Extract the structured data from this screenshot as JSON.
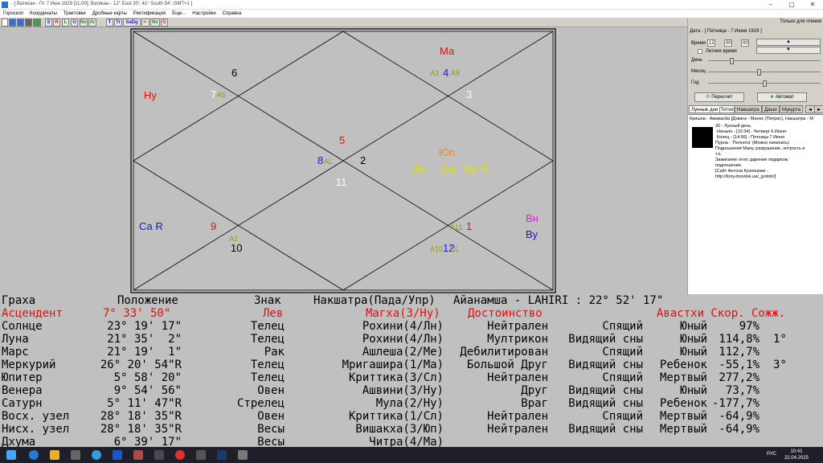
{
  "window": {
    "title": "- [ Ватикан - Пт  7 Июн 1929 [11:00]; Ватикан - 12° East 30'; 41° South 54'; GMT+1 ]",
    "minimize": "–",
    "maximize": "▢",
    "close": "✕"
  },
  "menu": [
    "Гороскоп",
    "Координаты",
    "Трактовки",
    "Дробные карты",
    "Ректификация",
    "Еще...",
    "Настройки",
    "Справка"
  ],
  "toolbar": {
    "buttons": [
      "S",
      "R",
      "L",
      "U",
      "Nv",
      "Ar",
      "T",
      "Tr",
      "SaDg",
      "<-",
      "Nv",
      "G"
    ]
  },
  "chart": {
    "houses": {
      "h1": "5",
      "h2": "6",
      "h3": "7",
      "h4": "8",
      "h5": "9",
      "h6": "10",
      "h7": "11",
      "h8": "12",
      "h9": "1",
      "h10": "2",
      "h11": "3",
      "h12": "4"
    },
    "labels": {
      "ma": "Ма",
      "nu": "Ну",
      "a5": "A5",
      "a3": "A3",
      "a8": "A8",
      "al": "AL",
      "yup": "Юп",
      "ln": "Лн",
      "sl": "Сл",
      "mer": "Ме R",
      "ca": "Са R",
      "a2": "A2",
      "a11": "A11",
      "a10": "A10",
      "ul": "UL",
      "vn": "Вн",
      "vu": "Ву"
    },
    "colors": {
      "red": "#e01010",
      "orange": "#f08a10",
      "yellow": "#e0e000",
      "blue": "#1a1acc",
      "olive": "#9a9a10",
      "white": "#ffffff",
      "magenta": "#e020e0"
    }
  },
  "panel": {
    "readonly": "Только для чтения",
    "date_label": "Дата - [ Пятница   - 7 Июня    1929 ]",
    "time_label": "Время",
    "time_h": "12",
    "time_m": "00",
    "time_s": "00",
    "dst_label": "Летнее время",
    "day_label": "День",
    "month_label": "Месяц",
    "year_label": "Год",
    "day_pos": 0.2,
    "month_pos": 0.45,
    "year_pos": 0.5,
    "recalc": "Пересчет",
    "auto": "Автомат",
    "tabs": [
      "Лунные дни [Титхи]",
      "Накшатра",
      "Даши",
      "Мукурта"
    ],
    "tab_prev": "◄",
    "tab_next": "►",
    "info": {
      "head": "Кришна - Амавасйа [Дэвата - Манес (Питрис), Накшатра - М",
      "l1": "30 - Лунный день",
      "l2": "Начало  - [10:34] - Четверг     6 Июня",
      "l3": "Конец  - [14:56] -  Пятница      7 Июня",
      "l4": "Пурна - 'Полнота' (Можно начинать)",
      "l5": "Подношения Ману, разрушение, хитрость и",
      "l6": "т.п.",
      "l7": "  Зажигание огня; дарение подарков;",
      "l8": "подношения.",
      "l9": "  [Сайт Антона Кузнецова -",
      "l10": "http://tony.donetsk.ua/_jyotish/]"
    }
  },
  "table": {
    "header": {
      "graha": "Граха",
      "pos": "Положение",
      "sign": "Знак",
      "nak": "Накшатра(Пада/Упр)",
      "ayan": "Айанамша - LAHIRI : 22° 52' 17\""
    },
    "asc_header": {
      "name": "Асцендент",
      "pos": "7° 33' 50\"",
      "sign": "Лев",
      "nak": "Магха(3/Ну)",
      "dig": "Достоинство",
      "av": "Авастхи Скор. Сожж."
    },
    "rows": [
      {
        "name": "Солнце",
        "pos": "23° 19' 17\"",
        "sign": "Телец",
        "nak": "Рохини(4/Лн)",
        "dig": "Нейтрален",
        "state": "Спящий",
        "age": "Юный",
        "speed": "97%",
        "comb": ""
      },
      {
        "name": "Луна",
        "pos": "21° 35'  2\"",
        "sign": "Телец",
        "nak": "Рохини(4/Лн)",
        "dig": "Мултрикон",
        "state": "Видящий сны",
        "age": "Юный",
        "speed": "114,8%",
        "comb": "1°"
      },
      {
        "name": "Марс",
        "pos": "21° 19'  1\"",
        "sign": "Рак",
        "nak": "Ашлеша(2/Ме)",
        "dig": "Дебилитирован",
        "state": "Спящий",
        "age": "Юный",
        "speed": "112,7%",
        "comb": ""
      },
      {
        "name": "Меркурий",
        "pos": "26° 20' 54\"R",
        "sign": "Телец",
        "nak": "Мригашира(1/Ма)",
        "dig": "Большой Друг",
        "state": "Видящий сны",
        "age": "Ребенок",
        "speed": "-55,1%",
        "comb": "3°"
      },
      {
        "name": "Юпитер",
        "pos": "5° 58' 20\"",
        "sign": "Телец",
        "nak": "Криттика(3/Сл)",
        "dig": "Нейтрален",
        "state": "Спящий",
        "age": "Мертвый",
        "speed": "277,2%",
        "comb": ""
      },
      {
        "name": "Венера",
        "pos": "9° 54' 56\"",
        "sign": "Овен",
        "nak": "Ашвини(3/Ну)",
        "dig": "Друг",
        "state": "Видящий сны",
        "age": "Юный",
        "speed": "73,7%",
        "comb": ""
      },
      {
        "name": "Сатурн",
        "pos": "5° 11' 47\"R",
        "sign": "Стрелец",
        "nak": "Мула(2/Ну)",
        "dig": "Враг",
        "state": "Видящий сны",
        "age": "Ребенок",
        "speed": "-177,7%",
        "comb": ""
      },
      {
        "name": "Восх. узел",
        "pos": "28° 18' 35\"R",
        "sign": "Овен",
        "nak": "Криттика(1/Сл)",
        "dig": "Нейтрален",
        "state": "Спящий",
        "age": "Мертвый",
        "speed": "-64,9%",
        "comb": ""
      },
      {
        "name": "Нисх. узел",
        "pos": "28° 18' 35\"R",
        "sign": "Весы",
        "nak": "Вишакха(3/Юп)",
        "dig": "Нейтрален",
        "state": "Видящий сны",
        "age": "Мертвый",
        "speed": "-64,9%",
        "comb": ""
      },
      {
        "name": "Дхума",
        "pos": "6° 39' 17\"",
        "sign": "Весы",
        "nak": "Читра(4/Ма)",
        "dig": "",
        "state": "",
        "age": "",
        "speed": "",
        "comb": ""
      }
    ]
  },
  "taskbar": {
    "lang": "РУС",
    "time": "10:41",
    "date": "22.04.2025"
  }
}
